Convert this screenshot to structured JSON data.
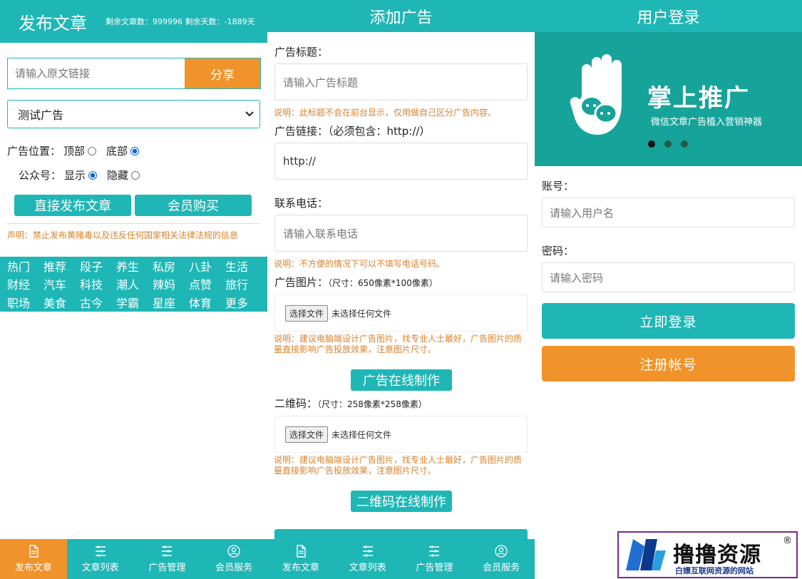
{
  "publish": {
    "title": "发布文章",
    "stats": "剩余文章数：999996 剩余天数：-1889天",
    "url_placeholder": "请输入原文链接",
    "share_label": "分享",
    "ad_select_value": "测试广告",
    "position_label": "广告位置：",
    "position_top": "顶部",
    "position_bottom": "底部",
    "account_label": "公众号：",
    "account_show": "显示",
    "account_hide": "隐藏",
    "direct_publish": "直接发布文章",
    "member_buy": "会员购买",
    "notice": "声明：禁止发布黄赌毒以及违反任何国家相关法律法规的信息",
    "categories": [
      "热门",
      "推荐",
      "段子",
      "养生",
      "私房",
      "八卦",
      "生活",
      "财经",
      "汽车",
      "科技",
      "潮人",
      "辣妈",
      "点赞",
      "旅行",
      "职场",
      "美食",
      "古今",
      "学霸",
      "星座",
      "体育",
      "更多"
    ]
  },
  "nav": {
    "items": [
      "发布文章",
      "文章列表",
      "广告管理",
      "会员服务"
    ]
  },
  "ad": {
    "title": "添加广告",
    "title_label": "广告标题：",
    "title_placeholder": "请输入广告标题",
    "title_hint": "说明：此标题不会在前台显示，仅用做自己区分广告内容。",
    "link_label": "广告链接：（必须包含：http://）",
    "link_value": "http://",
    "phone_label": "联系电话：",
    "phone_placeholder": "请输入联系电话",
    "phone_hint": "说明：不方便的情况下可以不填写电话号码。",
    "image_label": "广告图片：",
    "image_size": "（尺寸：650像素*100像素）",
    "choose_file": "选择文件",
    "no_file": "未选择任何文件",
    "image_hint": "说明：建议电脑端设计广告图片，找专业人士最好，广告图片的质量直接影响广告投放效果，注意图片尺寸。",
    "make_ad": "广告在线制作",
    "qr_label": "二维码：",
    "qr_size": "（尺寸：258像素*258像素）",
    "qr_hint": "说明：建议电脑端设计广告图片，找专业人士最好，广告图片的质量直接影响广告投放效果，注意图片尺寸。",
    "make_qr": "二维码在线制作"
  },
  "login": {
    "title": "用户登录",
    "brand_title": "掌上推广",
    "brand_sub": "微信文章广告植入营销神器",
    "account_label": "账号：",
    "account_placeholder": "请输入用户名",
    "password_label": "密码：",
    "password_placeholder": "请输入密码",
    "login_btn": "立即登录",
    "register_btn": "注册帐号"
  },
  "watermark": {
    "name": "撸撸资源",
    "slogan": "白嫖互联网资源的网站",
    "reg": "®"
  },
  "colors": {
    "teal": "#1fb6b6",
    "orange": "#f0932b",
    "banner": "#16a39a",
    "hint": "#d9822b"
  }
}
